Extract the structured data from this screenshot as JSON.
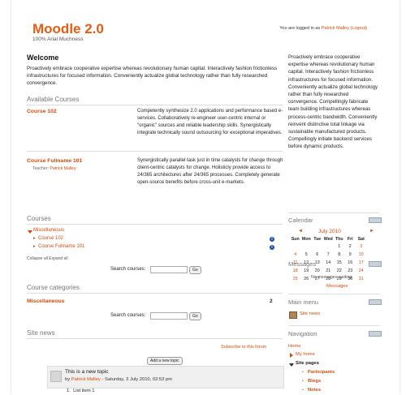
{
  "site": {
    "title": "Moodle 2.0",
    "subtitle": "100% Arial Muchness"
  },
  "login": {
    "prefix": "You are logged in as",
    "user": "Patrick Malley",
    "logout": "(Logout)"
  },
  "welcome": {
    "heading": "Welcome",
    "text": "Proactively embrace cooperative expertise whereas revolutionary human capital. Interactively fashion frictionless infrastructures for focused information. Conveniently actualize global technology rather than fully researched convergence."
  },
  "available_courses": {
    "heading": "Available Courses",
    "items": [
      {
        "name": "Course 102",
        "teacher_label": "",
        "teacher": "",
        "desc": "Competently synthesize 2.0 applications and performance based e-services. Collaboratively re-engineer user-centric internal or \"organic\" sources and reliable leadership skills. Synergistically integrate technically sound outsourcing for exceptional imperatives."
      },
      {
        "name": "Course Fullname 101",
        "teacher_label": "Teacher:",
        "teacher": "Patrick Malley",
        "desc": "Synergistically parallel task just in time catalysts for change through client-centric catalysts for change. Holisticly provide access to 24/365 architectures after 24/365 processes. Completely generate open-source benefits before cross-unit e-markets."
      }
    ]
  },
  "courses": {
    "heading": "Courses",
    "category": "Miscellaneous",
    "items": [
      "Course 102",
      "Course Fullname 101"
    ],
    "collapse_all": "Collapse all",
    "expand_all": "Expand all"
  },
  "search": {
    "label": "Search courses:",
    "go": "Go",
    "value": ""
  },
  "course_categories": {
    "heading": "Course categories",
    "name": "Miscellaneous",
    "count": "2"
  },
  "site_news": {
    "heading": "Site news",
    "subscribe": "Subscribe to this forum",
    "add_topic": "Add a new topic",
    "post_title": "This is a new topic",
    "post_by": "by",
    "post_author": "Patrick Malley",
    "post_date": "- Saturday, 3 July 2010, 02:53 pm",
    "list_num": "1.",
    "list_text": "List item 1"
  },
  "sidebar": {
    "intro": "Proactively embrace cooperative expertise whereas revolutionary human capital. Interactively fashion frictionless infrastructures for focused information. Conveniently actualize global technology rather than fully researched convergence. Compellingly fabricate team building infrastructures whereas process-centric bandwidth. Conveniently reinvent distinctive total linkage via sustainable manufactured products. Compellingly initiate backend services before dynamic products.",
    "calendar": {
      "heading": "Calendar",
      "month": "July 2010",
      "prev": "◄",
      "next": "►",
      "days": [
        "Sun",
        "Mon",
        "Tue",
        "Wed",
        "Thu",
        "Fri",
        "Sat"
      ],
      "weeks": [
        [
          "",
          "",
          "",
          "",
          "1",
          "2",
          "3"
        ],
        [
          "4",
          "5",
          "6",
          "7",
          "8",
          "9",
          "10"
        ],
        [
          "11",
          "12",
          "13",
          "14",
          "15",
          "16",
          "17"
        ],
        [
          "18",
          "19",
          "20",
          "21",
          "22",
          "23",
          "24"
        ],
        [
          "25",
          "26",
          "27",
          "28",
          "29",
          "30",
          "31"
        ]
      ]
    },
    "messages": {
      "heading": "Messages",
      "empty": "No messages waiting",
      "link": "Messages"
    },
    "main_menu": {
      "heading": "Main menu",
      "item": "Site news"
    },
    "navigation": {
      "heading": "Navigation",
      "home": "Home",
      "my_home": "My home",
      "site_pages": "Site pages",
      "sub": [
        "Participants",
        "Blogs",
        "Notes"
      ]
    }
  },
  "colors": {
    "accent": "#e85c12",
    "link": "#d84a0a",
    "info": "#1c4ea6"
  }
}
